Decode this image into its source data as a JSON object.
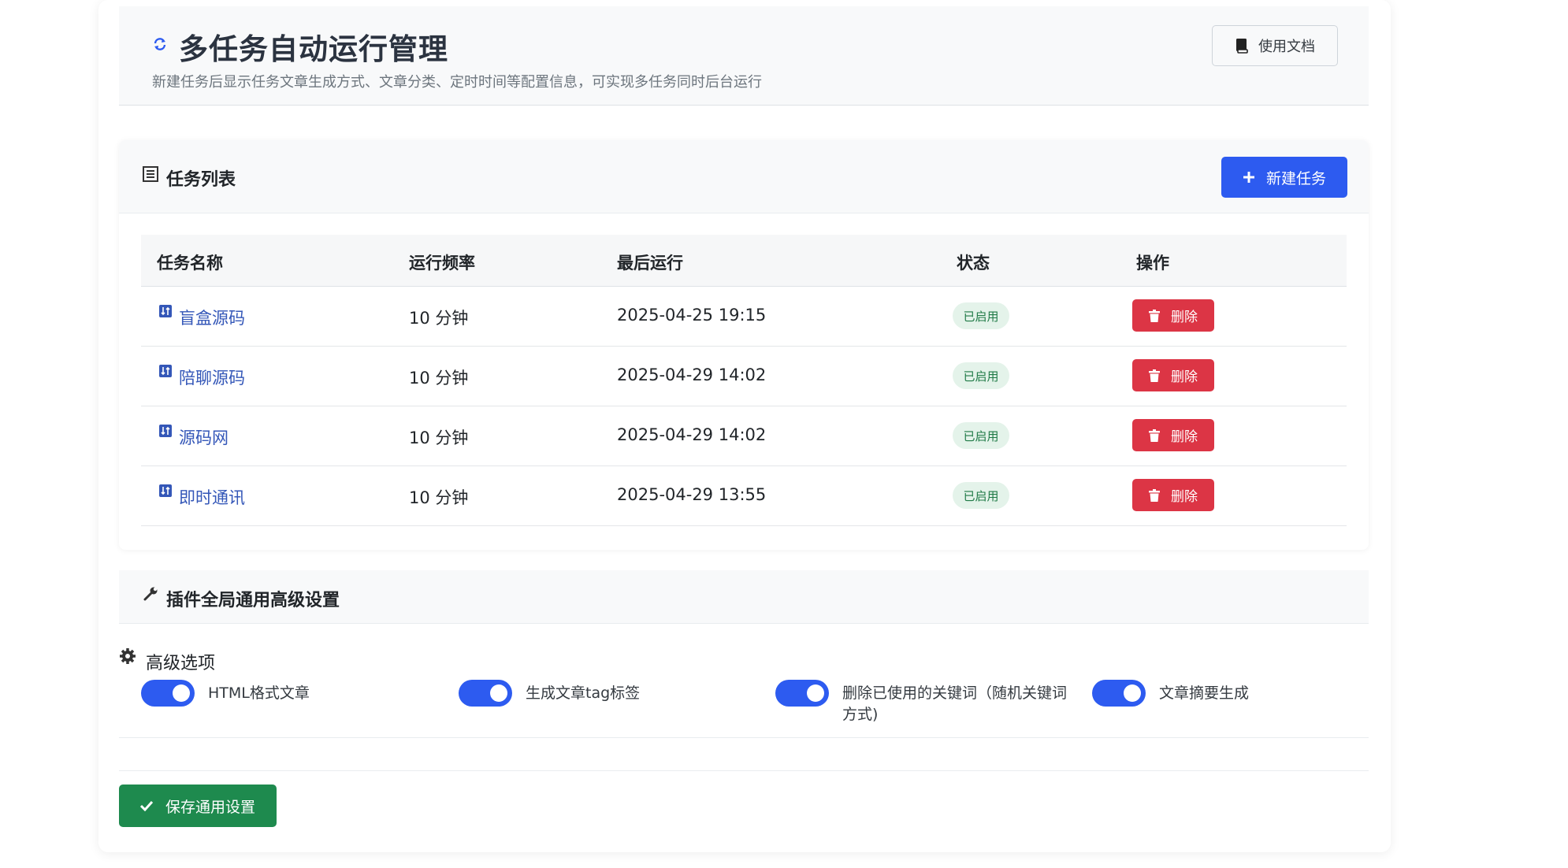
{
  "header": {
    "title": "多任务自动运行管理",
    "subtitle": "新建任务后显示任务文章生成方式、文章分类、定时时间等配置信息，可实现多任务同时后台运行",
    "doc_button": "使用文档"
  },
  "task_list": {
    "title": "任务列表",
    "new_button": "新建任务",
    "columns": [
      "任务名称",
      "运行频率",
      "最后运行",
      "状态",
      "操作"
    ],
    "rows": [
      {
        "name": "盲盒源码",
        "frequency": "10 分钟",
        "last_run": "2025-04-25 19:15",
        "status": "已启用",
        "action": "删除"
      },
      {
        "name": "陪聊源码",
        "frequency": "10 分钟",
        "last_run": "2025-04-29 14:02",
        "status": "已启用",
        "action": "删除"
      },
      {
        "name": "源码网",
        "frequency": "10 分钟",
        "last_run": "2025-04-29 14:02",
        "status": "已启用",
        "action": "删除"
      },
      {
        "name": "即时通讯",
        "frequency": "10 分钟",
        "last_run": "2025-04-29 13:55",
        "status": "已启用",
        "action": "删除"
      }
    ]
  },
  "settings": {
    "title": "插件全局通用高级设置",
    "advanced_title": "高级选项",
    "options": [
      {
        "label": "HTML格式文章",
        "enabled": true
      },
      {
        "label": "生成文章tag标签",
        "enabled": true
      },
      {
        "label": "删除已使用的关键词（随机关键词方式)",
        "enabled": true
      },
      {
        "label": "文章摘要生成",
        "enabled": true
      }
    ],
    "save_button": "保存通用设置"
  },
  "colors": {
    "primary": "#2d5bf0",
    "danger": "#dc3545",
    "success": "#1e8a4e",
    "badge_bg": "#e4f3ea",
    "link": "#3457b8"
  }
}
